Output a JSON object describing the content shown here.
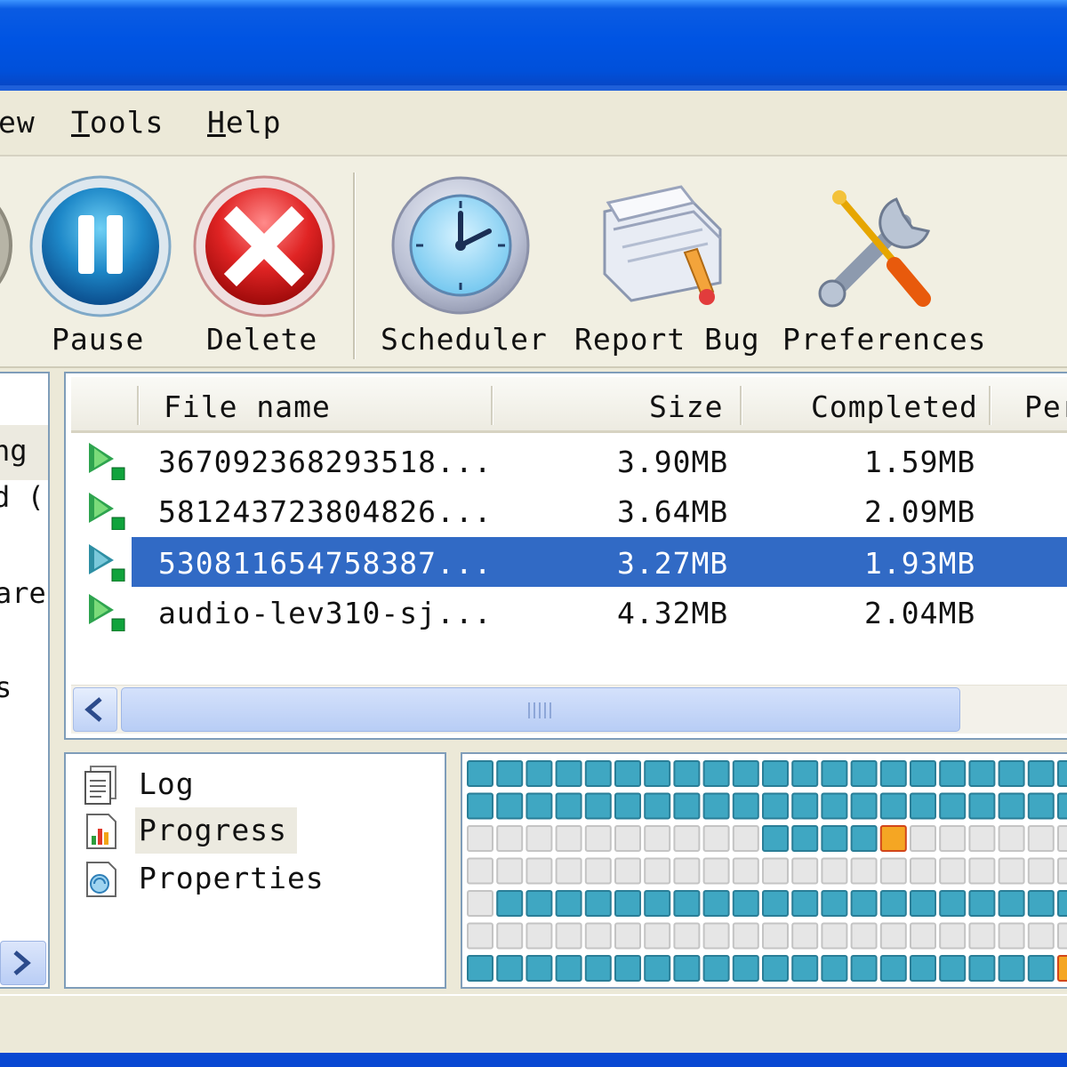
{
  "menu": {
    "items": [
      {
        "text": "ew",
        "underline": ""
      },
      {
        "text": "ools",
        "underline": "T"
      },
      {
        "text": "elp",
        "underline": "H"
      }
    ]
  },
  "toolbar": {
    "buttons": [
      {
        "label": "Pause",
        "icon": "pause-icon"
      },
      {
        "label": "Delete",
        "icon": "delete-icon"
      },
      {
        "label": "Scheduler",
        "icon": "clock-icon"
      },
      {
        "label": "Report Bug",
        "icon": "report-bug-icon"
      },
      {
        "label": "Preferences",
        "icon": "tools-icon"
      }
    ]
  },
  "sidebar": {
    "fragments": [
      "ng",
      "d (",
      "are",
      "s"
    ]
  },
  "filelist": {
    "columns": [
      "File name",
      "Size",
      "Completed",
      "Per"
    ],
    "rows": [
      {
        "name": "367092368293518...",
        "size": "3.90MB",
        "completed": "1.59MB"
      },
      {
        "name": "581243723804826...",
        "size": "3.64MB",
        "completed": "2.09MB"
      },
      {
        "name": "530811654758387...",
        "size": "3.27MB",
        "completed": "1.93MB",
        "selected": true
      },
      {
        "name": "audio-lev310-sj...",
        "size": "4.32MB",
        "completed": "2.04MB"
      }
    ]
  },
  "tree": {
    "items": [
      {
        "label": "Log",
        "icon": "log-icon"
      },
      {
        "label": "Progress",
        "icon": "progress-chart-icon",
        "active": true
      },
      {
        "label": "Properties",
        "icon": "properties-icon"
      }
    ]
  },
  "progress_grid": {
    "legend": {
      "done": "#3FA7C2",
      "empty": "#E6E6E6",
      "active": "#F5A623"
    },
    "rows": [
      "dddddddddddddddddddddd",
      "dddddddddddddddddddddd",
      "eeeeeeeeeeddddaeeeeeee",
      "eeeeeeeeeeeeeeeeeeeeee",
      "eddddddddddddddddddddd",
      "eeeeeeeeeeeeeeeeeeeeed",
      "ddddddddddddddddddddad"
    ]
  }
}
